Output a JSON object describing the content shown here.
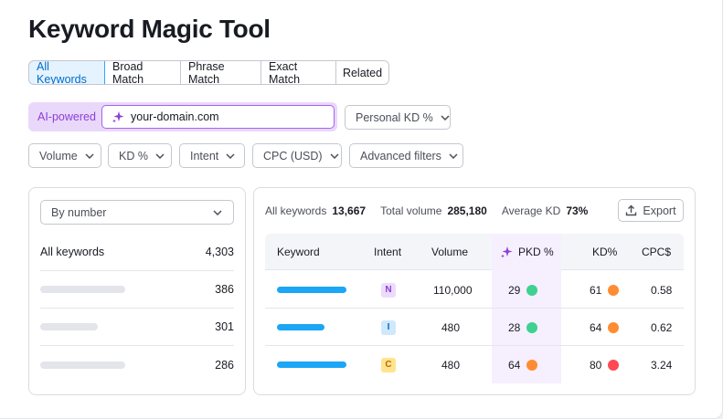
{
  "title": "Keyword Magic Tool",
  "tabs": [
    {
      "label": "All Keywords",
      "active": true
    },
    {
      "label": "Broad Match",
      "active": false
    },
    {
      "label": "Phrase Match",
      "active": false
    },
    {
      "label": "Exact Match",
      "active": false
    },
    {
      "label": "Related",
      "active": false
    }
  ],
  "ai": {
    "label": "AI-powered",
    "domain_value": "your-domain.com",
    "icon": "sparkle-icon"
  },
  "filters": {
    "personal_kd": "Personal KD %",
    "volume": "Volume",
    "kd": "KD %",
    "intent": "Intent",
    "cpc": "CPC (USD)",
    "advanced": "Advanced filters"
  },
  "left_panel": {
    "sort_select": "By number",
    "all_keywords_label": "All keywords",
    "all_keywords_count": "4,303",
    "groups": [
      {
        "count": "386"
      },
      {
        "count": "301"
      },
      {
        "count": "286"
      }
    ]
  },
  "stats": {
    "all_keywords_label": "All keywords",
    "all_keywords_value": "13,667",
    "total_volume_label": "Total volume",
    "total_volume_value": "285,180",
    "average_kd_label": "Average KD",
    "average_kd_value": "73%"
  },
  "export_label": "Export",
  "table": {
    "headers": {
      "keyword": "Keyword",
      "intent": "Intent",
      "volume": "Volume",
      "pkd": "PKD %",
      "kd": "KD%",
      "cpc": "CPC$"
    },
    "rows": [
      {
        "intent": "N",
        "intent_bg": "#ecdcfc",
        "intent_color": "#8b3fd6",
        "volume": "110,000",
        "pkd": "29",
        "pkd_color": "#3ed190",
        "kd": "61",
        "kd_color": "#ff8c33",
        "cpc": "0.58"
      },
      {
        "intent": "I",
        "intent_bg": "#cfe8fb",
        "intent_color": "#006dca",
        "volume": "480",
        "pkd": "28",
        "pkd_color": "#3ed190",
        "kd": "64",
        "kd_color": "#ff8c33",
        "cpc": "0.62"
      },
      {
        "intent": "C",
        "intent_bg": "#ffe38f",
        "intent_color": "#b86e00",
        "volume": "480",
        "pkd": "64",
        "pkd_color": "#ff8c33",
        "kd": "80",
        "kd_color": "#ff4953",
        "cpc": "3.24"
      }
    ]
  },
  "colors": {
    "accent_blue": "#2ea7ff",
    "ai_purple": "#a862ef",
    "keyword_bar": "#1ba6f6"
  }
}
